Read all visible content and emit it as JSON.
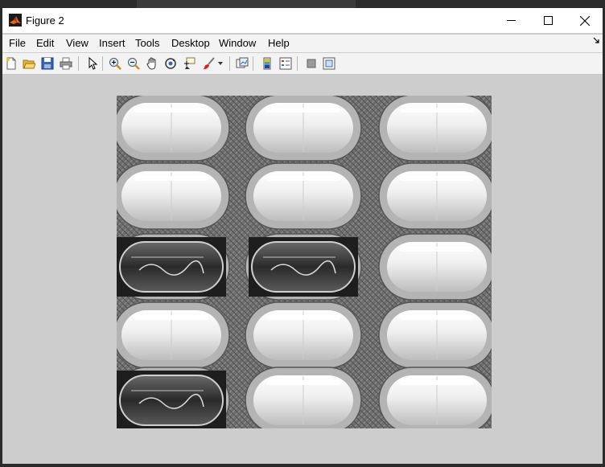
{
  "window": {
    "title": "Figure 2",
    "minimize_label": "—",
    "maximize_label": "☐",
    "close_label": "✕"
  },
  "menu": [
    "File",
    "Edit",
    "View",
    "Insert",
    "Tools",
    "Desktop",
    "Window",
    "Help"
  ],
  "toolbar": {
    "icons": [
      "new-figure-icon",
      "open-file-icon",
      "save-icon",
      "print-icon",
      "select-arrow-icon",
      "zoom-in-icon",
      "zoom-out-icon",
      "pan-hand-icon",
      "rotate-3d-icon",
      "data-cursor-icon",
      "brush-icon",
      "brush-dropdown-icon",
      "link-plot-icon",
      "colorbar-icon",
      "legend-icon",
      "hide-plot-tools-icon",
      "show-plot-tools-icon"
    ]
  },
  "image": {
    "description_kind": "grayscale blister pack photo",
    "grid_rows": 5,
    "grid_cols": 3,
    "empty_pockets": [
      [
        2,
        0
      ],
      [
        2,
        1
      ],
      [
        4,
        0
      ]
    ],
    "colors": {
      "background": "#cdcdcd",
      "foil": "#6b6b6b",
      "pill": "#e6e6e6"
    }
  }
}
